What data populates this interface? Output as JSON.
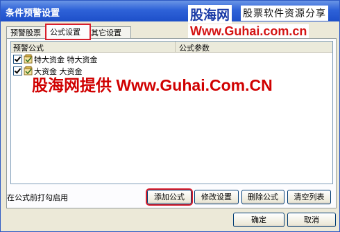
{
  "window": {
    "title": "条件预警设置"
  },
  "watermark": {
    "site_cn": "股海网",
    "tagline": "股票软件资源分享",
    "url": "Www.Guhai.com.cn",
    "center_text": "股海网提供 Www.Guhai.Com.CN"
  },
  "tabs": [
    {
      "label": "预警股票",
      "active": false
    },
    {
      "label": "公式设置",
      "active": true
    },
    {
      "label": "其它设置",
      "active": false
    }
  ],
  "list": {
    "columns": [
      "预警公式",
      "公式参数"
    ],
    "rows": [
      {
        "checked": true,
        "icon": "formula-icon",
        "formula": "特大资金 特大资金",
        "params": ""
      },
      {
        "checked": true,
        "icon": "formula-icon",
        "formula": "大资金 大资金",
        "params": ""
      }
    ]
  },
  "hint": "在公式前打勾启用",
  "buttons": {
    "add": "添加公式",
    "edit": "修改设置",
    "delete": "删除公式",
    "clear": "清空列表",
    "ok": "确定",
    "cancel": "取消"
  },
  "colors": {
    "titlebar": "#2e62d8",
    "highlight": "#d81e2c",
    "watermark_red": "#d00000"
  }
}
